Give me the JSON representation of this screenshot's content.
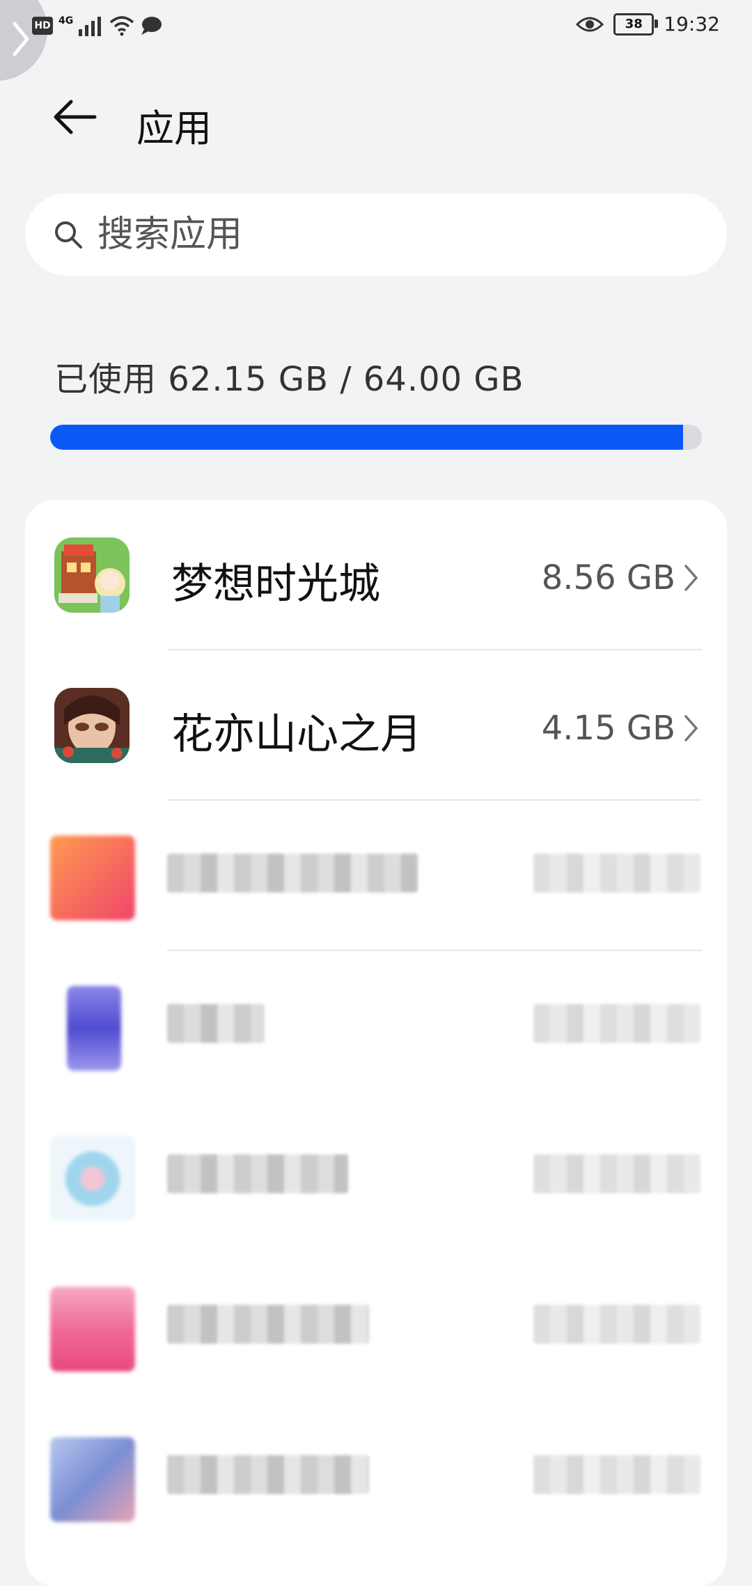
{
  "status_bar": {
    "left_badges": [
      "HD",
      "4G"
    ],
    "battery": "38",
    "time": "19:32"
  },
  "header": {
    "title": "应用"
  },
  "search": {
    "placeholder": "搜索应用"
  },
  "storage": {
    "text": "已使用 62.15 GB / 64.00 GB",
    "used_fraction": 0.971
  },
  "apps": [
    {
      "name": "梦想时光城",
      "size": "8.56 GB"
    },
    {
      "name": "花亦山心之月",
      "size": "4.15 GB"
    }
  ],
  "colors": {
    "accent": "#0a59f7",
    "background": "#f1f3f5"
  }
}
